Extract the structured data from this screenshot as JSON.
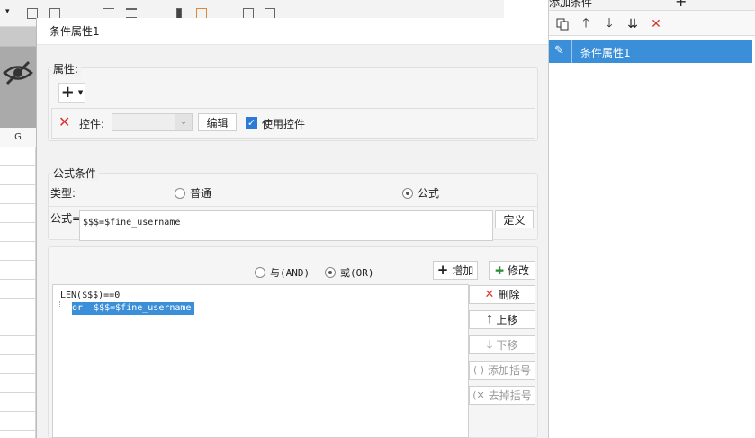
{
  "sheet": {
    "column_label": "G"
  },
  "outer": {
    "top_icon": "grid-icon"
  },
  "dialog": {
    "title": "条件属性1",
    "properties": {
      "label": "属性:",
      "add_button": "+",
      "control_label": "控件:",
      "control_value": "",
      "edit_button": "编辑",
      "use_control_label": "使用控件",
      "use_control_checked": true
    },
    "formula_condition": {
      "label": "公式条件",
      "type_label": "类型:",
      "type_options": [
        "普通",
        "公式"
      ],
      "type_selected": "公式",
      "formula_label": "公式=",
      "formula_value": "$$$=$fine_username",
      "define_button": "定义"
    },
    "logic": {
      "options": [
        "与(AND)",
        "或(OR)"
      ],
      "selected": "或(OR)",
      "add_button": "增加",
      "modify_button": "修改"
    },
    "condition_list": {
      "items": [
        {
          "text": "LEN($$$)==0",
          "selected": false
        },
        {
          "text": "or  $$$=$fine_username",
          "selected": true
        }
      ]
    },
    "list_actions": {
      "delete": "删除",
      "move_up": "上移",
      "move_down": "下移",
      "add_bracket": "添加括号",
      "remove_bracket": "去掉括号"
    }
  },
  "side_panel": {
    "header_label": "添加条件",
    "header_plus": "+",
    "items": [
      {
        "label": "条件属性1",
        "selected": true
      }
    ]
  },
  "colors": {
    "selection_blue": "#3b8fd8",
    "delete_red": "#d9342b",
    "check_blue": "#2a7ad6"
  }
}
